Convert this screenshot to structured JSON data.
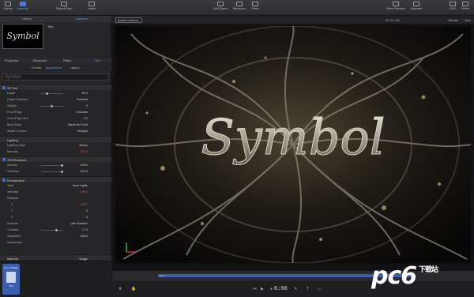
{
  "toolbar": {
    "left": [
      {
        "label": "Library",
        "icon": "library-icon"
      },
      {
        "label": "Inspector",
        "icon": "inspector-icon",
        "active": true
      },
      {
        "label": "Project Pane",
        "icon": "project-pane-icon"
      },
      {
        "label": "Import",
        "icon": "import-icon"
      }
    ],
    "center": [
      {
        "label": "Add Object",
        "icon": "add-object-icon"
      },
      {
        "label": "Behaviors",
        "icon": "behaviors-icon"
      },
      {
        "label": "Filters",
        "icon": "filters-icon"
      }
    ],
    "right": [
      {
        "label": "Make Particles",
        "icon": "particles-icon"
      },
      {
        "label": "Replicate",
        "icon": "replicate-icon"
      },
      {
        "label": "HUD",
        "icon": "hud-icon"
      },
      {
        "label": "Share",
        "icon": "share-icon"
      }
    ]
  },
  "leftpanel": {
    "tabs": [
      "Library",
      "Inspector"
    ],
    "preview_text": "Symbol",
    "layer_name": "Text",
    "inspector_tabs": [
      "Properties",
      "Behaviors",
      "Filters",
      "Text"
    ],
    "text_subtabs": [
      "Format",
      "Appearance",
      "Layout"
    ],
    "text_value": "Symbol"
  },
  "sections": {
    "face3d": "3D Text",
    "lighting": "Lighting",
    "shadows": "Self Shadows",
    "environment": "Environment",
    "material": "Material"
  },
  "rows": {
    "depth": {
      "label": "Depth",
      "value": "30.0"
    },
    "depth_direction": {
      "label": "Depth Direction",
      "value": "Forward"
    },
    "weight": {
      "label": "Weight",
      "value": "0"
    },
    "front_edge": {
      "label": "Front Edge",
      "value": "Concave"
    },
    "front_edge_size": {
      "label": "Front Edge Size",
      "value": "3.0"
    },
    "back_edge": {
      "label": "Back Edge",
      "value": "Same As Front"
    },
    "inside_corners": {
      "label": "Inside Corners",
      "value": "Straight"
    },
    "lighting_style": {
      "label": "Lighting Style",
      "value": "Above"
    },
    "intensity": {
      "label": "Intensity",
      "value": "130.0"
    },
    "opacity": {
      "label": "Opacity",
      "value": "100.0"
    },
    "softness": {
      "label": "Softness",
      "value": "100.0"
    },
    "type": {
      "label": "Type",
      "value": "Spot Lights"
    },
    "env_intensity": {
      "label": "Intensity",
      "value": "230.0"
    },
    "rotation": {
      "label": "Rotation",
      "value": ""
    },
    "rot_x": {
      "label": "X",
      "value": "165.7"
    },
    "rot_y": {
      "label": "Y",
      "value": "0"
    },
    "rot_z": {
      "label": "Z",
      "value": "0"
    },
    "animate": {
      "label": "Animate",
      "value": "Use Rotation"
    },
    "contrast": {
      "label": "Contrast",
      "value": "77.0"
    },
    "saturation": {
      "label": "Saturation",
      "value": "100.0"
    },
    "anisotropic": {
      "label": "Anisotropic",
      "value": ""
    },
    "material_mode": {
      "label": "Single"
    }
  },
  "thumb": {
    "label": "ALL LAYERS",
    "name": "Text"
  },
  "canvas": {
    "camera": "Active Camera",
    "fit": "Fit: 13.7%",
    "render": "Render",
    "view": "View",
    "artwork_text": "Symbol"
  },
  "timeline": {
    "bar_label": "Text",
    "timecode": "6:06"
  },
  "watermark": {
    "main": "pc6",
    "sub": "下载站"
  },
  "colors": {
    "accent": "#4a79d8",
    "warning": "#e05555"
  }
}
